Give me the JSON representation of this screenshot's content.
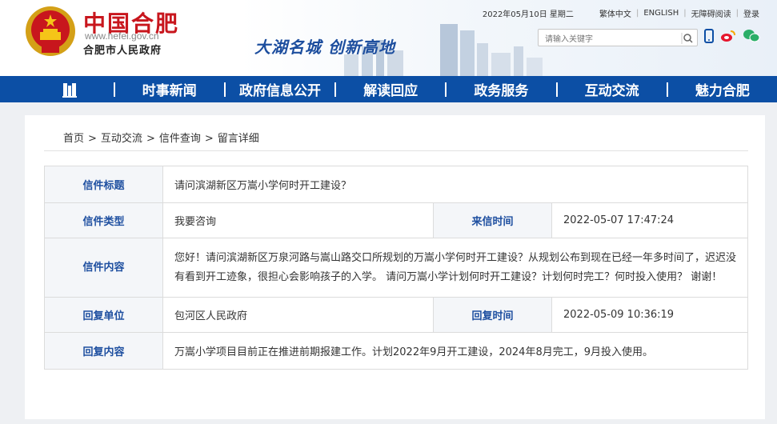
{
  "header": {
    "site_name": "中国合肥",
    "site_url": "www.hefei.gov.cn",
    "gov_name": "合肥市人民政府",
    "slogan": "大湖名城  创新高地",
    "date": "2022年05月10日 星期二",
    "links": [
      "繁体中文",
      "ENGLISH",
      "无障碍阅读",
      "登录"
    ],
    "search_placeholder": "请输入关键字",
    "brand_color": "#c8161d"
  },
  "nav": {
    "items": [
      "时事新闻",
      "政府信息公开",
      "解读回应",
      "政务服务",
      "互动交流",
      "魅力合肥"
    ],
    "bg_color": "#0c4fa5"
  },
  "breadcrumb": [
    "首页",
    "互动交流",
    "信件查询",
    "留言详细"
  ],
  "letter": {
    "title_label": "信件标题",
    "title": "请问滨湖新区万嵩小学何时开工建设？",
    "type_label": "信件类型",
    "type": "我要咨询",
    "sent_label": "来信时间",
    "sent_time": "2022-05-07 17:47:24",
    "content_label": "信件内容",
    "content_line1": "您好！请问滨湖新区万泉河路与嵩山路交口所规划的万嵩小学何时开工建设？从规划公布到现在已经一年多时间了，迟迟没",
    "content_line2": "有看到开工迹象，很担心会影响孩子的入学。  请问万嵩小学计划何时开工建设？计划何时完工？何时投入使用？ 谢谢！",
    "reply_unit_label": "回复单位",
    "reply_unit": "包河区人民政府",
    "reply_time_label": "回复时间",
    "reply_time": "2022-05-09 10:36:19",
    "reply_content_label": "回复内容",
    "reply_content": "万嵩小学项目目前正在推进前期报建工作。计划2022年9月开工建设，2024年8月完工，9月投入使用。"
  }
}
